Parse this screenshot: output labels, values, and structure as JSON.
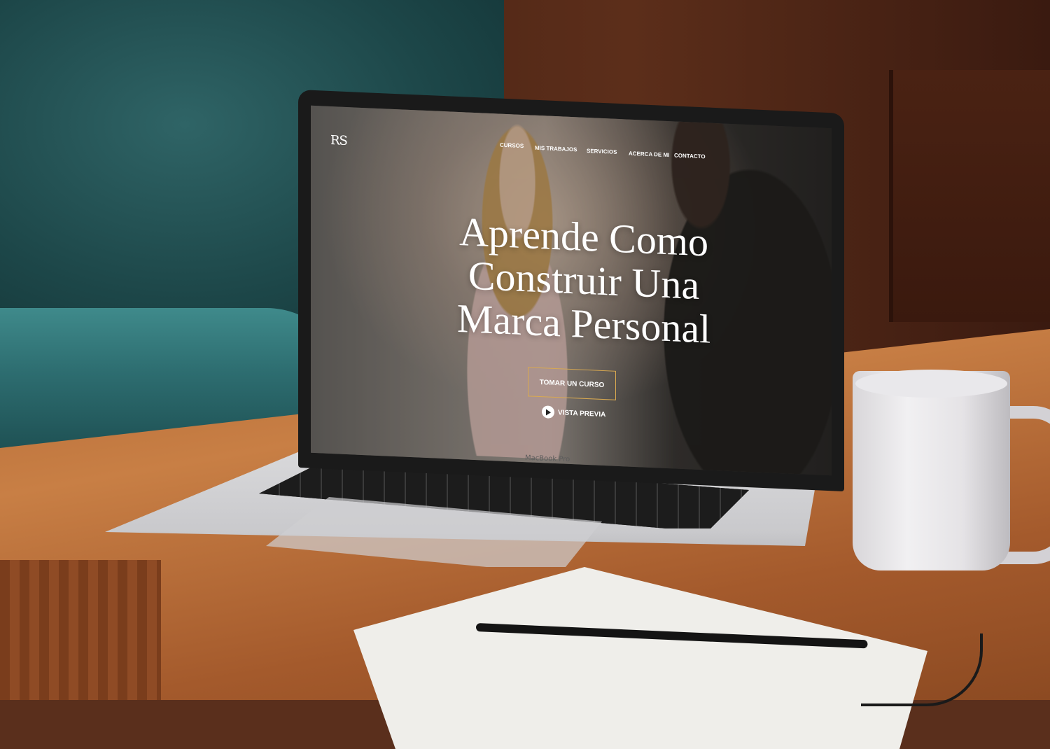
{
  "site": {
    "logo": "RS",
    "nav": [
      {
        "label": "CURSOS"
      },
      {
        "label": "MIS TRABAJOS"
      },
      {
        "label": "SERVICIOS"
      },
      {
        "label": "ACERCA DE MI"
      },
      {
        "label": "CONTACTO"
      }
    ],
    "hero": {
      "title_line1": "Aprende Como",
      "title_line2": "Construir Una",
      "title_line3": "Marca Personal",
      "cta_label": "TOMAR UN CURSO",
      "preview_label": "VISTA PREVIA",
      "preview_icon": "play-icon"
    }
  },
  "device": {
    "brand": "MacBook Pro"
  },
  "colors": {
    "cta_border": "#d9a950",
    "text": "#ffffff"
  }
}
